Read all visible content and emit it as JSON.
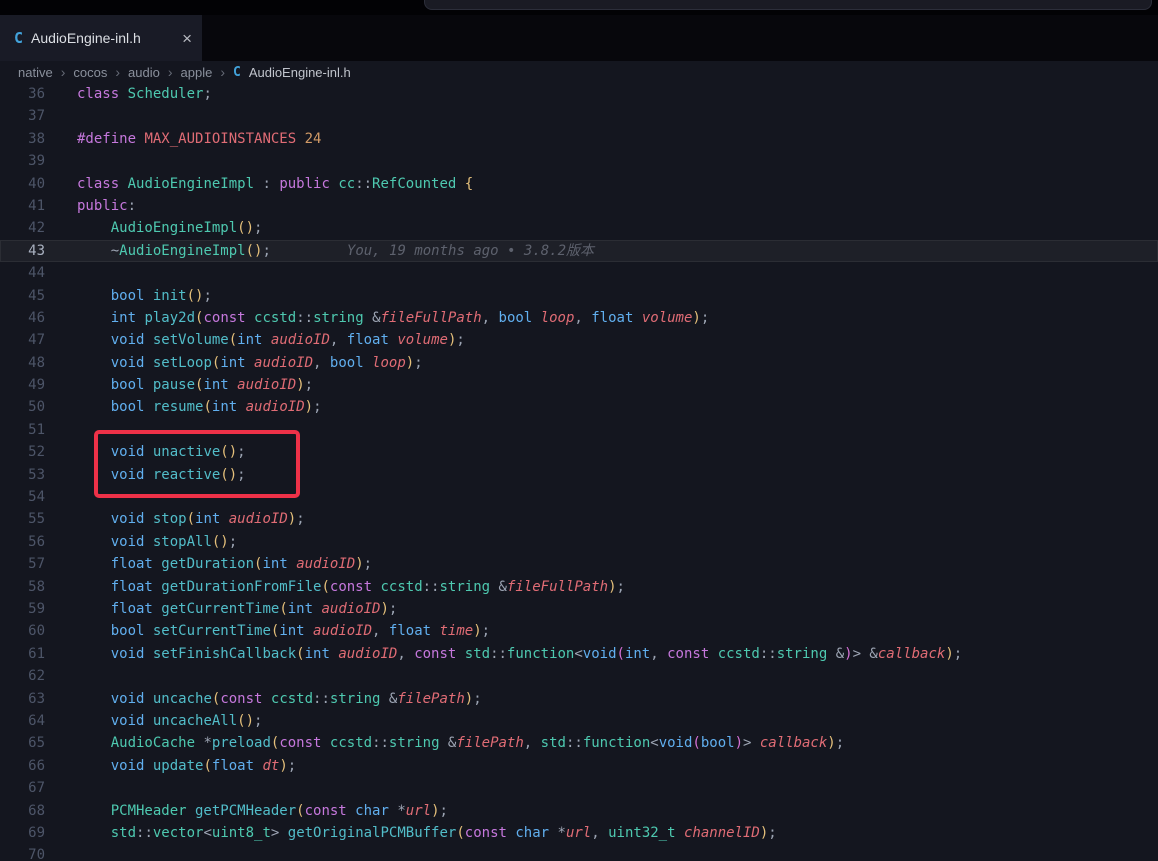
{
  "colors": {
    "editor_bg": "#14161f",
    "tabbar_bg": "#07070c",
    "active_tab_bg": "#191b26",
    "c_icon_blue": "#42a2da",
    "keyword_purple": "#c678dd",
    "type_blue": "#61afef",
    "class_teal": "#4ec9b0",
    "function_cyan": "#52bdc9",
    "parameter_red": "#e06c75",
    "number_orange": "#d19a66",
    "bracket_gold": "#e5c07b",
    "annotation_red": "#ee3148"
  },
  "tab": {
    "label": "AudioEngine-inl.h",
    "icon_glyph": "C",
    "close_glyph": "×"
  },
  "breadcrumb": {
    "items": [
      "native",
      "cocos",
      "audio",
      "apple"
    ],
    "separator": "›",
    "file_icon_glyph": "C",
    "file": "AudioEngine-inl.h"
  },
  "editor": {
    "current_line": 43,
    "blame_line": 43,
    "blame": "You, 19 months ago • 3.8.2版本",
    "token_classes": {
      "k": "keyword",
      "t": "primitive-type",
      "c": "class-or-namespace",
      "f": "function-name",
      "p": "parameter",
      "m": "macro",
      "n": "number",
      "d": "punctuation",
      "b": "bracket-level-1",
      "b2": "bracket-level-2"
    },
    "lines": [
      {
        "n": 36,
        "t": [
          [
            "k",
            "class"
          ],
          [
            "d",
            " "
          ],
          [
            "c",
            "Scheduler"
          ],
          [
            "d",
            ";"
          ]
        ]
      },
      {
        "n": 37,
        "t": []
      },
      {
        "n": 38,
        "t": [
          [
            "k",
            "#define"
          ],
          [
            "m",
            " MAX_AUDIOINSTANCES"
          ],
          [
            "n",
            " 24"
          ]
        ]
      },
      {
        "n": 39,
        "t": []
      },
      {
        "n": 40,
        "t": [
          [
            "k",
            "class"
          ],
          [
            "c",
            " AudioEngineImpl"
          ],
          [
            "d",
            " : "
          ],
          [
            "k",
            "public"
          ],
          [
            "c",
            " cc"
          ],
          [
            "d",
            "::"
          ],
          [
            "c",
            "RefCounted"
          ],
          [
            "b",
            " {"
          ]
        ]
      },
      {
        "n": 41,
        "t": [
          [
            "k",
            "public"
          ],
          [
            "d",
            ":"
          ]
        ]
      },
      {
        "n": 42,
        "t": [
          [
            "d",
            "    "
          ],
          [
            "c",
            "AudioEngineImpl"
          ],
          [
            "b",
            "()"
          ],
          [
            "d",
            ";"
          ]
        ]
      },
      {
        "n": 43,
        "t": [
          [
            "d",
            "    ~"
          ],
          [
            "c",
            "AudioEngineImpl"
          ],
          [
            "b",
            "()"
          ],
          [
            "d",
            ";"
          ]
        ]
      },
      {
        "n": 44,
        "t": []
      },
      {
        "n": 45,
        "t": [
          [
            "d",
            "    "
          ],
          [
            "t",
            "bool"
          ],
          [
            "f",
            " init"
          ],
          [
            "b",
            "()"
          ],
          [
            "d",
            ";"
          ]
        ]
      },
      {
        "n": 46,
        "t": [
          [
            "d",
            "    "
          ],
          [
            "t",
            "int"
          ],
          [
            "f",
            " play2d"
          ],
          [
            "b",
            "("
          ],
          [
            "k",
            "const"
          ],
          [
            "c",
            " ccstd"
          ],
          [
            "d",
            "::"
          ],
          [
            "c",
            "string"
          ],
          [
            "d",
            " &"
          ],
          [
            "p",
            "fileFullPath"
          ],
          [
            "d",
            ", "
          ],
          [
            "t",
            "bool"
          ],
          [
            "p",
            " loop"
          ],
          [
            "d",
            ", "
          ],
          [
            "t",
            "float"
          ],
          [
            "p",
            " volume"
          ],
          [
            "b",
            ")"
          ],
          [
            "d",
            ";"
          ]
        ]
      },
      {
        "n": 47,
        "t": [
          [
            "d",
            "    "
          ],
          [
            "t",
            "void"
          ],
          [
            "f",
            " setVolume"
          ],
          [
            "b",
            "("
          ],
          [
            "t",
            "int"
          ],
          [
            "p",
            " audioID"
          ],
          [
            "d",
            ", "
          ],
          [
            "t",
            "float"
          ],
          [
            "p",
            " volume"
          ],
          [
            "b",
            ")"
          ],
          [
            "d",
            ";"
          ]
        ]
      },
      {
        "n": 48,
        "t": [
          [
            "d",
            "    "
          ],
          [
            "t",
            "void"
          ],
          [
            "f",
            " setLoop"
          ],
          [
            "b",
            "("
          ],
          [
            "t",
            "int"
          ],
          [
            "p",
            " audioID"
          ],
          [
            "d",
            ", "
          ],
          [
            "t",
            "bool"
          ],
          [
            "p",
            " loop"
          ],
          [
            "b",
            ")"
          ],
          [
            "d",
            ";"
          ]
        ]
      },
      {
        "n": 49,
        "t": [
          [
            "d",
            "    "
          ],
          [
            "t",
            "bool"
          ],
          [
            "f",
            " pause"
          ],
          [
            "b",
            "("
          ],
          [
            "t",
            "int"
          ],
          [
            "p",
            " audioID"
          ],
          [
            "b",
            ")"
          ],
          [
            "d",
            ";"
          ]
        ]
      },
      {
        "n": 50,
        "t": [
          [
            "d",
            "    "
          ],
          [
            "t",
            "bool"
          ],
          [
            "f",
            " resume"
          ],
          [
            "b",
            "("
          ],
          [
            "t",
            "int"
          ],
          [
            "p",
            " audioID"
          ],
          [
            "b",
            ")"
          ],
          [
            "d",
            ";"
          ]
        ]
      },
      {
        "n": 51,
        "t": []
      },
      {
        "n": 52,
        "t": [
          [
            "d",
            "    "
          ],
          [
            "t",
            "void"
          ],
          [
            "f",
            " unactive"
          ],
          [
            "b",
            "()"
          ],
          [
            "d",
            ";"
          ]
        ]
      },
      {
        "n": 53,
        "t": [
          [
            "d",
            "    "
          ],
          [
            "t",
            "void"
          ],
          [
            "f",
            " reactive"
          ],
          [
            "b",
            "()"
          ],
          [
            "d",
            ";"
          ]
        ]
      },
      {
        "n": 54,
        "t": []
      },
      {
        "n": 55,
        "t": [
          [
            "d",
            "    "
          ],
          [
            "t",
            "void"
          ],
          [
            "f",
            " stop"
          ],
          [
            "b",
            "("
          ],
          [
            "t",
            "int"
          ],
          [
            "p",
            " audioID"
          ],
          [
            "b",
            ")"
          ],
          [
            "d",
            ";"
          ]
        ]
      },
      {
        "n": 56,
        "t": [
          [
            "d",
            "    "
          ],
          [
            "t",
            "void"
          ],
          [
            "f",
            " stopAll"
          ],
          [
            "b",
            "()"
          ],
          [
            "d",
            ";"
          ]
        ]
      },
      {
        "n": 57,
        "t": [
          [
            "d",
            "    "
          ],
          [
            "t",
            "float"
          ],
          [
            "f",
            " getDuration"
          ],
          [
            "b",
            "("
          ],
          [
            "t",
            "int"
          ],
          [
            "p",
            " audioID"
          ],
          [
            "b",
            ")"
          ],
          [
            "d",
            ";"
          ]
        ]
      },
      {
        "n": 58,
        "t": [
          [
            "d",
            "    "
          ],
          [
            "t",
            "float"
          ],
          [
            "f",
            " getDurationFromFile"
          ],
          [
            "b",
            "("
          ],
          [
            "k",
            "const"
          ],
          [
            "c",
            " ccstd"
          ],
          [
            "d",
            "::"
          ],
          [
            "c",
            "string"
          ],
          [
            "d",
            " &"
          ],
          [
            "p",
            "fileFullPath"
          ],
          [
            "b",
            ")"
          ],
          [
            "d",
            ";"
          ]
        ]
      },
      {
        "n": 59,
        "t": [
          [
            "d",
            "    "
          ],
          [
            "t",
            "float"
          ],
          [
            "f",
            " getCurrentTime"
          ],
          [
            "b",
            "("
          ],
          [
            "t",
            "int"
          ],
          [
            "p",
            " audioID"
          ],
          [
            "b",
            ")"
          ],
          [
            "d",
            ";"
          ]
        ]
      },
      {
        "n": 60,
        "t": [
          [
            "d",
            "    "
          ],
          [
            "t",
            "bool"
          ],
          [
            "f",
            " setCurrentTime"
          ],
          [
            "b",
            "("
          ],
          [
            "t",
            "int"
          ],
          [
            "p",
            " audioID"
          ],
          [
            "d",
            ", "
          ],
          [
            "t",
            "float"
          ],
          [
            "p",
            " time"
          ],
          [
            "b",
            ")"
          ],
          [
            "d",
            ";"
          ]
        ]
      },
      {
        "n": 61,
        "t": [
          [
            "d",
            "    "
          ],
          [
            "t",
            "void"
          ],
          [
            "f",
            " setFinishCallback"
          ],
          [
            "b",
            "("
          ],
          [
            "t",
            "int"
          ],
          [
            "p",
            " audioID"
          ],
          [
            "d",
            ", "
          ],
          [
            "k",
            "const"
          ],
          [
            "c",
            " std"
          ],
          [
            "d",
            "::"
          ],
          [
            "c",
            "function"
          ],
          [
            "d",
            "<"
          ],
          [
            "t",
            "void"
          ],
          [
            "b2",
            "("
          ],
          [
            "t",
            "int"
          ],
          [
            "d",
            ", "
          ],
          [
            "k",
            "const"
          ],
          [
            "c",
            " ccstd"
          ],
          [
            "d",
            "::"
          ],
          [
            "c",
            "string"
          ],
          [
            "d",
            " &"
          ],
          [
            "b2",
            ")"
          ],
          [
            "d",
            "> &"
          ],
          [
            "p",
            "callback"
          ],
          [
            "b",
            ")"
          ],
          [
            "d",
            ";"
          ]
        ]
      },
      {
        "n": 62,
        "t": []
      },
      {
        "n": 63,
        "t": [
          [
            "d",
            "    "
          ],
          [
            "t",
            "void"
          ],
          [
            "f",
            " uncache"
          ],
          [
            "b",
            "("
          ],
          [
            "k",
            "const"
          ],
          [
            "c",
            " ccstd"
          ],
          [
            "d",
            "::"
          ],
          [
            "c",
            "string"
          ],
          [
            "d",
            " &"
          ],
          [
            "p",
            "filePath"
          ],
          [
            "b",
            ")"
          ],
          [
            "d",
            ";"
          ]
        ]
      },
      {
        "n": 64,
        "t": [
          [
            "d",
            "    "
          ],
          [
            "t",
            "void"
          ],
          [
            "f",
            " uncacheAll"
          ],
          [
            "b",
            "()"
          ],
          [
            "d",
            ";"
          ]
        ]
      },
      {
        "n": 65,
        "t": [
          [
            "d",
            "    "
          ],
          [
            "c",
            "AudioCache"
          ],
          [
            "d",
            " *"
          ],
          [
            "f",
            "preload"
          ],
          [
            "b",
            "("
          ],
          [
            "k",
            "const"
          ],
          [
            "c",
            " ccstd"
          ],
          [
            "d",
            "::"
          ],
          [
            "c",
            "string"
          ],
          [
            "d",
            " &"
          ],
          [
            "p",
            "filePath"
          ],
          [
            "d",
            ", "
          ],
          [
            "c",
            "std"
          ],
          [
            "d",
            "::"
          ],
          [
            "c",
            "function"
          ],
          [
            "d",
            "<"
          ],
          [
            "t",
            "void"
          ],
          [
            "b2",
            "("
          ],
          [
            "t",
            "bool"
          ],
          [
            "b2",
            ")"
          ],
          [
            "d",
            "> "
          ],
          [
            "p",
            "callback"
          ],
          [
            "b",
            ")"
          ],
          [
            "d",
            ";"
          ]
        ]
      },
      {
        "n": 66,
        "t": [
          [
            "d",
            "    "
          ],
          [
            "t",
            "void"
          ],
          [
            "f",
            " update"
          ],
          [
            "b",
            "("
          ],
          [
            "t",
            "float"
          ],
          [
            "p",
            " dt"
          ],
          [
            "b",
            ")"
          ],
          [
            "d",
            ";"
          ]
        ]
      },
      {
        "n": 67,
        "t": []
      },
      {
        "n": 68,
        "t": [
          [
            "d",
            "    "
          ],
          [
            "c",
            "PCMHeader"
          ],
          [
            "f",
            " getPCMHeader"
          ],
          [
            "b",
            "("
          ],
          [
            "k",
            "const"
          ],
          [
            "t",
            " char"
          ],
          [
            "d",
            " *"
          ],
          [
            "p",
            "url"
          ],
          [
            "b",
            ")"
          ],
          [
            "d",
            ";"
          ]
        ]
      },
      {
        "n": 69,
        "t": [
          [
            "d",
            "    "
          ],
          [
            "c",
            "std"
          ],
          [
            "d",
            "::"
          ],
          [
            "c",
            "vector"
          ],
          [
            "d",
            "<"
          ],
          [
            "c",
            "uint8_t"
          ],
          [
            "d",
            "> "
          ],
          [
            "f",
            "getOriginalPCMBuffer"
          ],
          [
            "b",
            "("
          ],
          [
            "k",
            "const"
          ],
          [
            "t",
            " char"
          ],
          [
            "d",
            " *"
          ],
          [
            "p",
            "url"
          ],
          [
            "d",
            ", "
          ],
          [
            "c",
            "uint32_t"
          ],
          [
            "p",
            " channelID"
          ],
          [
            "b",
            ")"
          ],
          [
            "d",
            ";"
          ]
        ]
      },
      {
        "n": 70,
        "t": []
      }
    ]
  }
}
